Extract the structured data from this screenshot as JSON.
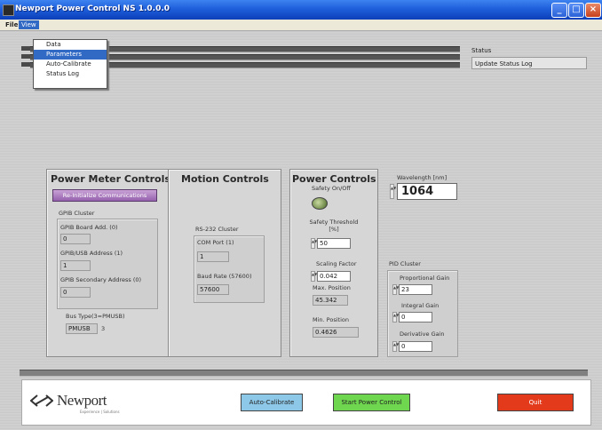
{
  "window": {
    "title": "Newport Power Control NS 1.0.0.0"
  },
  "menubar": {
    "file": "File",
    "view": "View"
  },
  "view_menu": {
    "items": [
      "Data",
      "Parameters",
      "Auto-Calibrate",
      "Status Log"
    ],
    "selected": "Parameters"
  },
  "status": {
    "label": "Status",
    "value": "Update Status Log"
  },
  "power_meter": {
    "title": "Power Meter Controls",
    "reinit_button": "Re-Initialize Communications",
    "gpib_cluster": "GPIB Cluster",
    "board_label": "GPIB Board Add. (0)",
    "board_value": "0",
    "address_label": "GPIB/USB Address (1)",
    "address_value": "1",
    "secondary_label": "GPIB Secondary Address (0)",
    "secondary_value": "0",
    "bus_label": "Bus Type(3=PMUSB)",
    "bus_type": "PMUSB",
    "bus_value": "3"
  },
  "motion": {
    "title": "Motion Controls",
    "rs232_cluster": "RS-232 Cluster",
    "com_label": "COM Port (1)",
    "com_value": "1",
    "baud_label": "Baud Rate (57600)",
    "baud_value": "57600"
  },
  "power_controls": {
    "title": "Power Controls",
    "safety_label": "Safety On/Off",
    "threshold_label": "Safety Threshold [%]",
    "threshold_value": "50",
    "scaling_label": "Scaling Factor",
    "scaling_value": "0.042",
    "max_label": "Max. Position",
    "max_value": "45.342",
    "min_label": "Min. Position",
    "min_value": "0.4626"
  },
  "wavelength": {
    "label": "Wavelength [nm]",
    "value": "1064"
  },
  "pid": {
    "title": "PID Cluster",
    "p_label": "Proportional Gain",
    "p_value": "23",
    "i_label": "Integral Gain",
    "i_value": "0",
    "d_label": "Derivative Gain",
    "d_value": "0"
  },
  "footer": {
    "logo": "Newport",
    "tagline": "Experience | Solutions",
    "autocal_button": "Auto-Calibrate",
    "start_button": "Start Power Control",
    "quit_button": "Quit"
  },
  "colors": {
    "titlebar": "#1f5fdb",
    "reinit_button": "#9561ad",
    "autocal_button": "#8ec8e8",
    "start_button": "#6fd64f",
    "quit_button": "#e33a1c"
  }
}
